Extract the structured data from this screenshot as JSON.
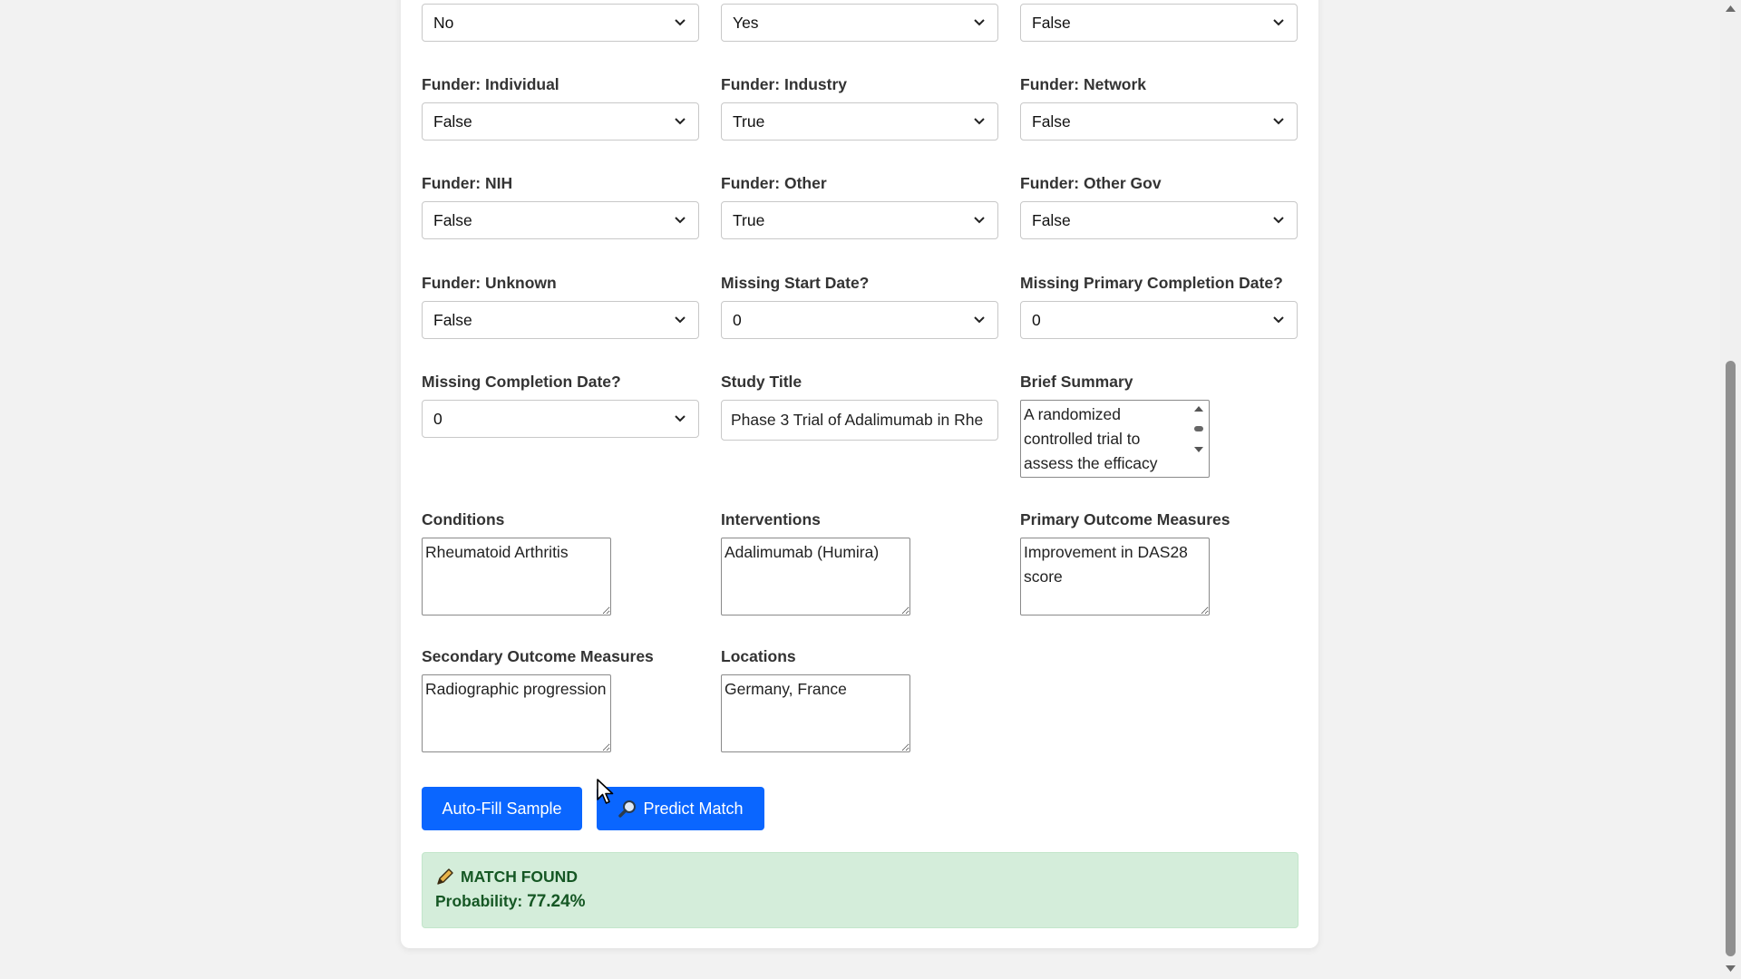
{
  "row0": {
    "select1_value": "No",
    "select2_value": "Yes",
    "select3_value": "False"
  },
  "fields": {
    "funder_individual": {
      "label": "Funder: Individual",
      "value": "False"
    },
    "funder_industry": {
      "label": "Funder: Industry",
      "value": "True"
    },
    "funder_network": {
      "label": "Funder: Network",
      "value": "False"
    },
    "funder_nih": {
      "label": "Funder: NIH",
      "value": "False"
    },
    "funder_other": {
      "label": "Funder: Other",
      "value": "True"
    },
    "funder_other_gov": {
      "label": "Funder: Other Gov",
      "value": "False"
    },
    "funder_unknown": {
      "label": "Funder: Unknown",
      "value": "False"
    },
    "missing_start_date": {
      "label": "Missing Start Date?",
      "value": "0"
    },
    "missing_primary_completion_date": {
      "label": "Missing Primary Completion Date?",
      "value": "0"
    },
    "missing_completion_date": {
      "label": "Missing Completion Date?",
      "value": "0"
    },
    "study_title": {
      "label": "Study Title",
      "value": "Phase 3 Trial of Adalimumab in Rhe"
    },
    "brief_summary": {
      "label": "Brief Summary",
      "value": "A randomized controlled trial to assess the efficacy"
    },
    "conditions": {
      "label": "Conditions",
      "value": "Rheumatoid Arthritis"
    },
    "interventions": {
      "label": "Interventions",
      "value": "Adalimumab (Humira)"
    },
    "primary_outcome_measures": {
      "label": "Primary Outcome Measures",
      "value": "Improvement in DAS28 score"
    },
    "secondary_outcome_measures": {
      "label": "Secondary Outcome Measures",
      "value": "Radiographic progression"
    },
    "locations": {
      "label": "Locations",
      "value": "Germany, France"
    }
  },
  "buttons": {
    "autofill_label": "Auto-Fill Sample",
    "predict_label": "Predict Match",
    "predict_icon": "magnifier-icon"
  },
  "result": {
    "icon": "pencil-icon",
    "status": "MATCH FOUND",
    "probability_label": "Probability:",
    "probability_value": "77.24%"
  },
  "colors": {
    "primary_button": "#0a66ff",
    "success_bg": "#d4edda",
    "success_text": "#155724"
  }
}
